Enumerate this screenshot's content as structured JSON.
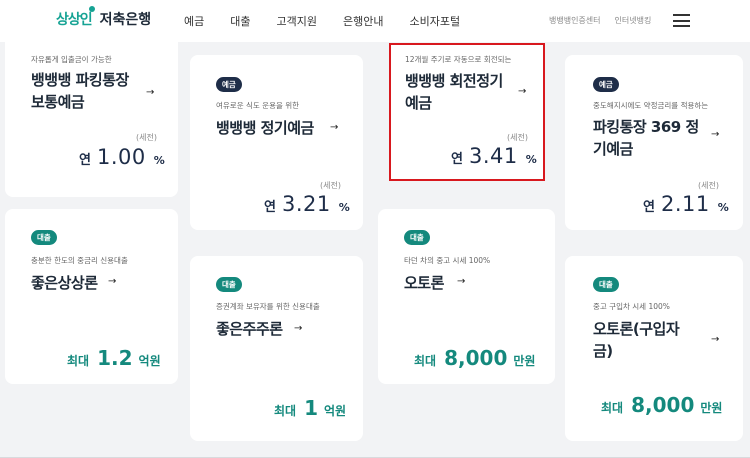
{
  "header": {
    "logo": "상상인",
    "logo_sub": "저축은행",
    "nav": [
      "예금",
      "대출",
      "고객지원",
      "은행안내",
      "소비자포털"
    ],
    "util": [
      "뱅뱅뱅인증센터",
      "인터넷뱅킹"
    ]
  },
  "colors": {
    "navy": "#1e2d48",
    "teal": "#14897d",
    "highlight": "#d8181e"
  },
  "deposits": [
    {
      "desc": "자유롭게 입출금이 가능한",
      "title_1": "뱅뱅뱅 파킹통장",
      "title_2": "보통예금",
      "note": "(세전)",
      "rate_pre": "연",
      "rate": "1.00",
      "rate_unit": "%"
    },
    {
      "badge": "예금",
      "desc": "여유로운 식도 운용을 위한",
      "title_1": "뱅뱅뱅 정기예금",
      "note": "(세전)",
      "rate_pre": "연",
      "rate": "3.21",
      "rate_unit": "%"
    },
    {
      "desc": "12개월 주기로 자동으로 회전되는",
      "title_1": "뱅뱅뱅 회전정기",
      "title_2": "예금",
      "note": "(세전)",
      "rate_pre": "연",
      "rate": "3.41",
      "rate_unit": "%"
    },
    {
      "badge": "예금",
      "desc": "중도해지시에도 약정금리를 적용하는",
      "title_1": "파킹통장 369 정",
      "title_2": "기예금",
      "note": "(세전)",
      "rate_pre": "연",
      "rate": "2.11",
      "rate_unit": "%"
    }
  ],
  "loans": [
    {
      "badge": "대출",
      "desc": "충분한 한도의 중금리 신용대출",
      "title_1": "좋은상상론",
      "pre": "최대",
      "amount": "1.2",
      "unit": "억원"
    },
    {
      "badge": "대출",
      "desc": "증권계좌 보유자를 위한 신용대출",
      "title_1": "좋은주주론",
      "pre": "최대",
      "amount": "1",
      "unit": "억원"
    },
    {
      "badge": "대출",
      "desc": "타던 차의 중고 시세 100%",
      "title_1": "오토론",
      "pre": "최대",
      "amount": "8,000",
      "unit": "만원"
    },
    {
      "badge": "대출",
      "desc": "중고 구입차 시세 100%",
      "title_1": "오토론(구입자",
      "title_2": "금)",
      "pre": "최대",
      "amount": "8,000",
      "unit": "만원"
    }
  ]
}
